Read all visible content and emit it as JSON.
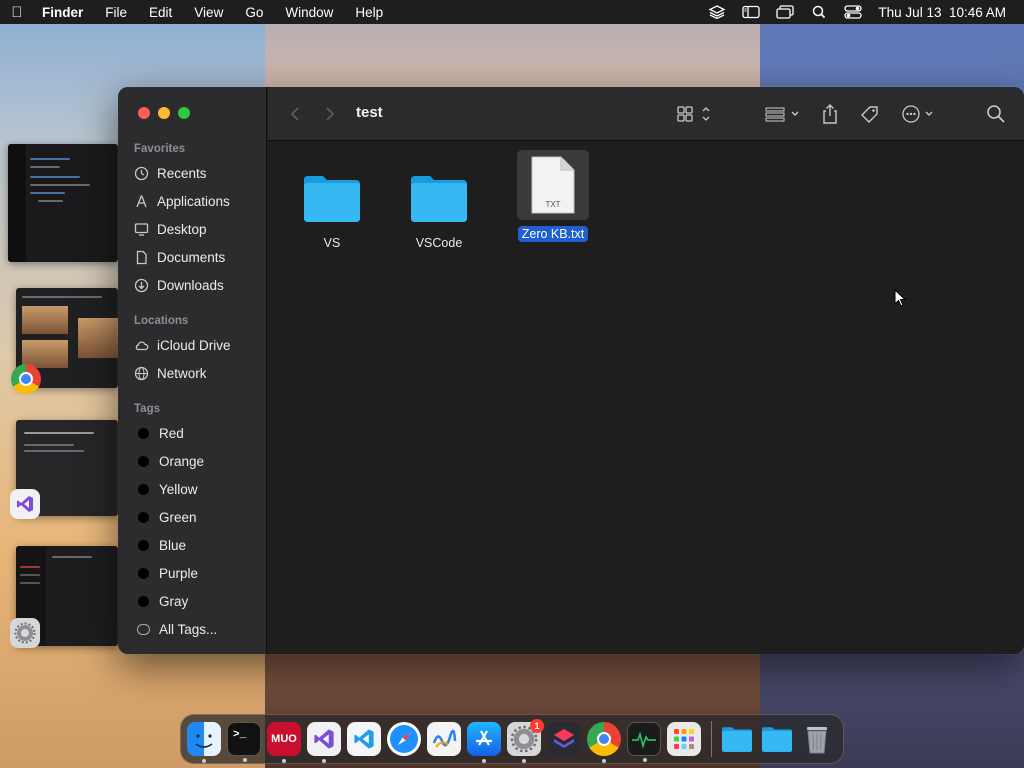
{
  "menubar": {
    "app_name": "Finder",
    "items": [
      "File",
      "Edit",
      "View",
      "Go",
      "Window",
      "Help"
    ],
    "datetime": "Thu Jul 13  10:46 AM",
    "status_icons": [
      "layers-icon",
      "sidebar-icon",
      "screen-mirror-icon",
      "spotlight-search-icon",
      "control-center-icon"
    ]
  },
  "finder": {
    "title": "test",
    "sidebar": {
      "favorites_header": "Favorites",
      "favorites": [
        {
          "label": "Recents",
          "icon": "clock-icon"
        },
        {
          "label": "Applications",
          "icon": "applications-icon"
        },
        {
          "label": "Desktop",
          "icon": "desktop-icon"
        },
        {
          "label": "Documents",
          "icon": "document-icon"
        },
        {
          "label": "Downloads",
          "icon": "download-icon"
        }
      ],
      "locations_header": "Locations",
      "locations": [
        {
          "label": "iCloud Drive",
          "icon": "cloud-icon"
        },
        {
          "label": "Network",
          "icon": "globe-icon"
        }
      ],
      "tags_header": "Tags",
      "tags": [
        "Red",
        "Orange",
        "Yellow",
        "Green",
        "Blue",
        "Purple",
        "Gray"
      ],
      "all_tags": "All Tags..."
    },
    "files": [
      {
        "name": "VS",
        "type": "folder"
      },
      {
        "name": "VSCode",
        "type": "folder"
      },
      {
        "name": "Zero KB.txt",
        "type": "txt",
        "badge": "TXT",
        "selected": true
      }
    ]
  },
  "dock": {
    "apps": [
      {
        "name": "Finder",
        "icon": "finder-icon",
        "color": "#1e88f5"
      },
      {
        "name": "Terminal",
        "icon": "terminal-icon",
        "color": "#111111"
      },
      {
        "name": "MUO",
        "icon": "muo-icon",
        "label": "MUO",
        "color": "#c8102e"
      },
      {
        "name": "Visual Studio",
        "icon": "visual-studio-icon",
        "color": "#7d4cdb"
      },
      {
        "name": "VS Code",
        "icon": "vscode-icon",
        "color": "#1f9cf0"
      },
      {
        "name": "Safari",
        "icon": "safari-icon",
        "color": "#1e90ff"
      },
      {
        "name": "Freeform",
        "icon": "freeform-icon",
        "color": "#f4f4f4"
      },
      {
        "name": "App Store",
        "icon": "app-store-icon",
        "color": "#1c8cf0"
      },
      {
        "name": "System Settings",
        "icon": "settings-icon",
        "color": "#8e8e93",
        "badge": "1"
      },
      {
        "name": "Shortcuts",
        "icon": "shortcuts-icon",
        "color": "#5856d6"
      },
      {
        "name": "Chrome",
        "icon": "chrome-icon",
        "color": "#ffffff"
      },
      {
        "name": "Activity Monitor",
        "icon": "activity-monitor-icon",
        "color": "#1b1b1b"
      },
      {
        "name": "Launchpad",
        "icon": "launchpad-icon",
        "color": "#e9e9e9"
      }
    ],
    "stacks": [
      {
        "name": "Folder",
        "icon": "folder-icon"
      },
      {
        "name": "Downloads",
        "icon": "folder-icon"
      },
      {
        "name": "Trash",
        "icon": "trash-icon"
      }
    ]
  },
  "colors": {
    "selection": "#1f5fd1",
    "folder": "#1ba8ea",
    "sidebar_bg": "#2c2c2e",
    "window_bg": "#1e1e1e"
  }
}
